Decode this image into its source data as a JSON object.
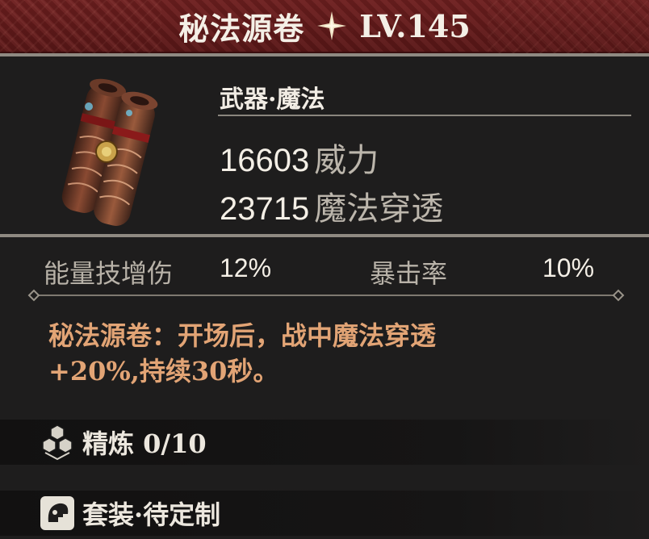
{
  "header": {
    "title": "秘法源卷",
    "level": "LV.145"
  },
  "item": {
    "category": "武器·魔法",
    "stats": [
      {
        "value": "16603",
        "label": "威力"
      },
      {
        "value": "23715",
        "label": "魔法穿透"
      }
    ]
  },
  "substats": [
    {
      "label": "能量技增伤",
      "value": "12%"
    },
    {
      "label": "暴击率",
      "value": "10%"
    }
  ],
  "description": {
    "line1": "秘法源卷：开场后，战中魔法穿透",
    "line2": "+20%,持续30秒。"
  },
  "refine": {
    "label": "精炼 0/10"
  },
  "set": {
    "label": "套装·待定制"
  },
  "colors": {
    "header_red": "#6e1f1f",
    "desc_orange": "#e2a475",
    "background": "#1e1d1d"
  }
}
